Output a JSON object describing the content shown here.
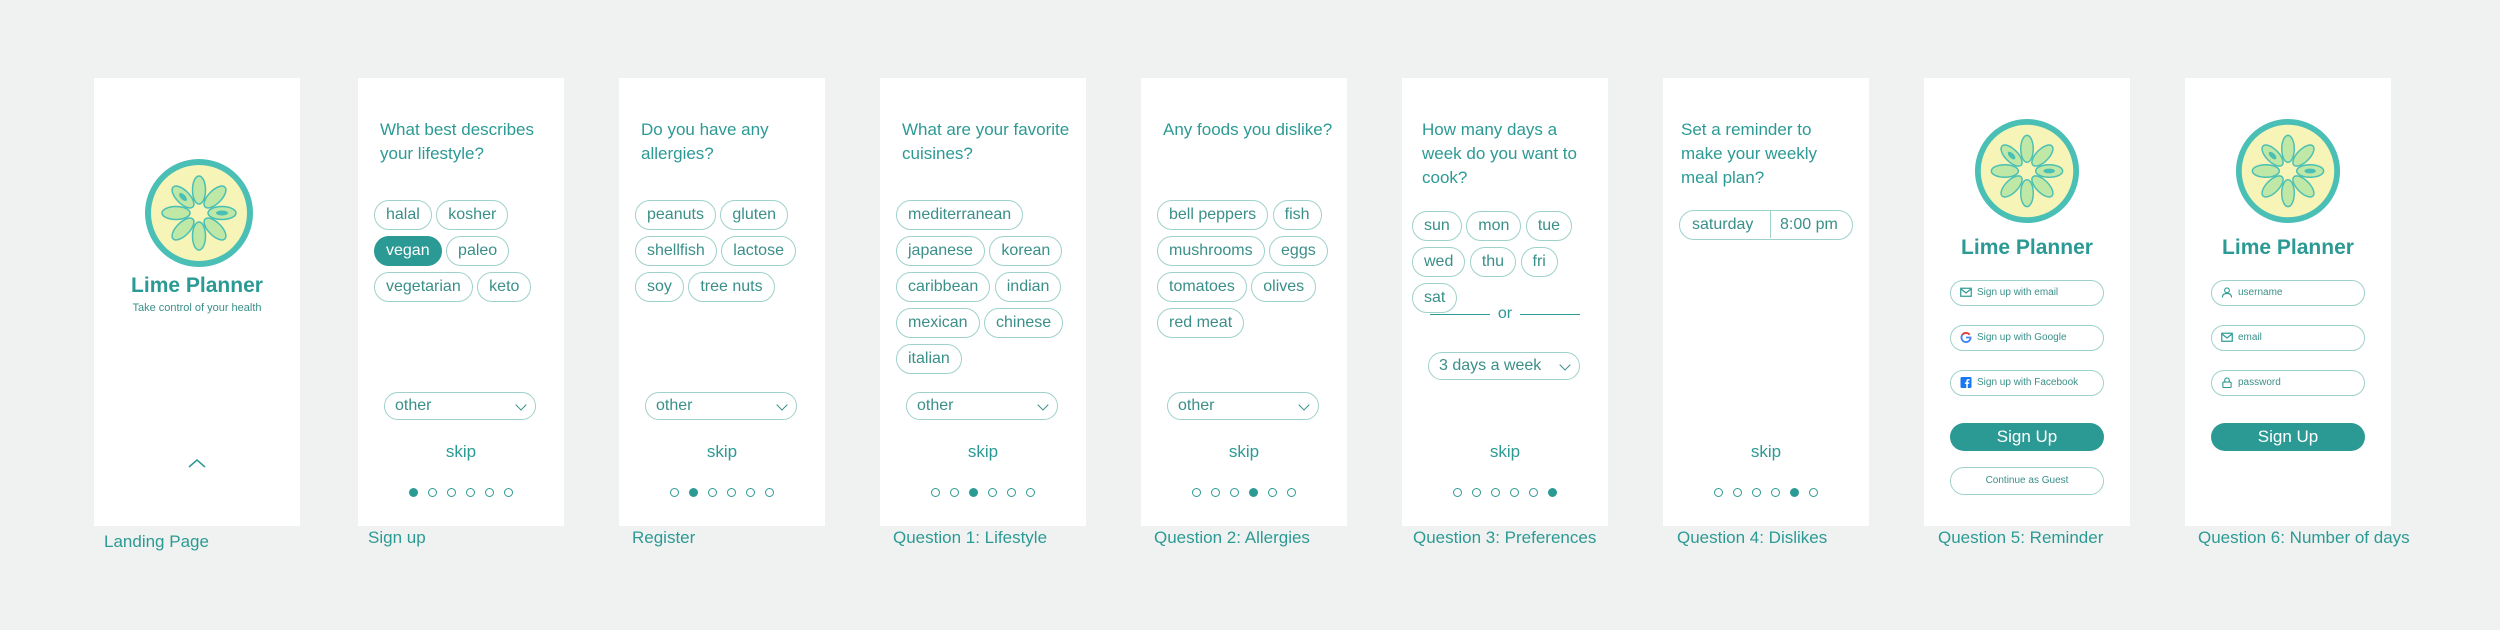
{
  "colors": {
    "accent": "#2c9a94",
    "chip_border": "#9fd1cb",
    "background": "#f0f2f1",
    "logo_ring": "#49bfb5",
    "logo_fill": "#f6f4b6",
    "segment_fill": "#bfe8a6"
  },
  "captions": [
    "Landing Page",
    "Sign up",
    "Register",
    "Question 1: Lifestyle",
    "Question 2: Allergies",
    "Question 3: Preferences",
    "Question 4: Dislikes",
    "Question 5: Reminder",
    "Question 6: Number of days"
  ],
  "landing": {
    "app_name": "Lime Planner",
    "tagline": "Take control of your health",
    "icon": "chevron-up-icon"
  },
  "lifestyle": {
    "question": "What best describes your lifestyle?",
    "chips": [
      "halal",
      "kosher",
      "vegan",
      "paleo",
      "vegetarian",
      "keto"
    ],
    "selected": "vegan",
    "select_value": "other",
    "skip": "skip",
    "step": 1,
    "total_steps": 6
  },
  "allergies": {
    "question": "Do you have any allergies?",
    "chips": [
      "peanuts",
      "gluten",
      "shellfish",
      "lactose",
      "soy",
      "tree nuts"
    ],
    "select_value": "other",
    "skip": "skip",
    "step": 2,
    "total_steps": 6
  },
  "cuisines": {
    "question": "What are your favorite cuisines?",
    "chips": [
      "mediterranean",
      "japanese",
      "korean",
      "caribbean",
      "indian",
      "mexican",
      "chinese",
      "italian"
    ],
    "select_value": "other",
    "skip": "skip",
    "step": 3,
    "total_steps": 6
  },
  "dislikes": {
    "question": "Any foods you dislike?",
    "chips": [
      "bell peppers",
      "fish",
      "mushrooms",
      "eggs",
      "tomatoes",
      "olives",
      "red meat"
    ],
    "select_value": "other",
    "skip": "skip",
    "step": 4,
    "total_steps": 6
  },
  "days": {
    "question": "How many days a week do you want to cook?",
    "chips": [
      "sun",
      "mon",
      "tue",
      "wed",
      "thu",
      "fri",
      "sat"
    ],
    "or_label": "or",
    "select_value": "3 days a week",
    "skip": "skip",
    "step": 6,
    "total_steps": 6
  },
  "reminder": {
    "question": "Set a reminder to make your weekly meal plan?",
    "day": "saturday",
    "time": "8:00 pm",
    "skip": "skip",
    "step": 5,
    "total_steps": 6
  },
  "signup": {
    "app_name": "Lime Planner",
    "email_label": "Sign up with email",
    "google_label": "Sign up with Google",
    "facebook_label": "Sign up with Facebook",
    "signup_button": "Sign Up",
    "guest_button": "Continue as Guest"
  },
  "register": {
    "app_name": "Lime Planner",
    "username_placeholder": "username",
    "email_placeholder": "email",
    "password_placeholder": "password",
    "signup_button": "Sign Up"
  }
}
